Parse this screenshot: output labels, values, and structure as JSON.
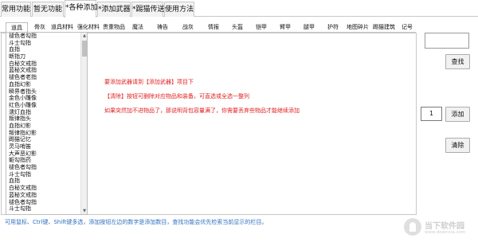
{
  "top_tabs": [
    {
      "label": "常用功能"
    },
    {
      "label": "暂无功能"
    },
    {
      "label": "*各种添加"
    },
    {
      "label": "*添加武器"
    },
    {
      "label": "*踢猫传送"
    },
    {
      "label": "使用方法"
    }
  ],
  "sub_tabs": [
    {
      "label": "道具"
    },
    {
      "label": "骨灰"
    },
    {
      "label": "道具材料"
    },
    {
      "label": "强化材料"
    },
    {
      "label": "贵重物品"
    },
    {
      "label": "魔法"
    },
    {
      "label": "祷告"
    },
    {
      "label": "战灰"
    },
    {
      "label": "情报"
    },
    {
      "label": "头盔"
    },
    {
      "label": "铠甲"
    },
    {
      "label": "臂甲"
    },
    {
      "label": "腿甲"
    },
    {
      "label": "护符"
    },
    {
      "label": "地图碎片"
    },
    {
      "label": "踢猫建筑"
    },
    {
      "label": "记号"
    }
  ],
  "item_list": [
    "褪色者勾指",
    "斗士勾指",
    "血指",
    "断指刀",
    "白秘文戒指",
    "蓝秘文戒指",
    "褪色者老指",
    "血指幻影",
    "瞬界者指头",
    "金色小雕像",
    "红色小雕像",
    "濡灯血指",
    "叛律指头",
    "血指幻影",
    "叛律指幻影",
    "踢猫记忆",
    "灵马哨笛",
    "大声恶幻影",
    "躯勾指药",
    "褪色者勾指",
    "斗士勾指",
    "血指",
    "白秘文戒指",
    "蓝秘文戒指",
    "褪色者勾指",
    "斗士勾指"
  ],
  "info_lines": [
    "要添加武器请到【添加武器】项目下",
    "【清除】按钮可删除对应物品和装备，可直选或全选一整列",
    "如果突然加不进物品了，那说明背包容量满了，你需要丢弃些物品才能继续添加"
  ],
  "controls": {
    "search_value": "",
    "search_label": "查找",
    "quantity_value": "1",
    "add_label": "添加",
    "clear_label": "清除"
  },
  "hint": "可用鼠标、Ctrl键、Shift键多选，添加按钮左边的数字是添加数目，查找功能会优先检索当前显示的栏目。",
  "watermark": {
    "title": "当下软件园",
    "url": "www.downxia.com"
  },
  "colors": {
    "info_text": "#e02020",
    "hint_text": "#2f6ec0"
  }
}
